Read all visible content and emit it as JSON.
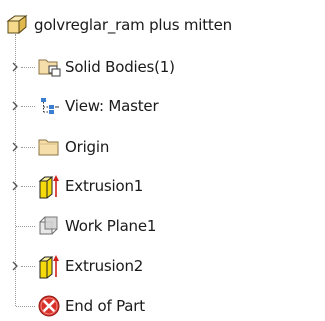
{
  "browser_tree": {
    "root": {
      "label": "golvreglar_ram plus mitten",
      "icon": "part-icon"
    },
    "items": [
      {
        "label": "Solid Bodies(1)",
        "icon": "solid-bodies-folder-icon",
        "expandable": true
      },
      {
        "label": "View: Master",
        "icon": "view-rep-icon",
        "expandable": true
      },
      {
        "label": "Origin",
        "icon": "folder-icon",
        "expandable": true
      },
      {
        "label": "Extrusion1",
        "icon": "extrusion-icon",
        "expandable": true
      },
      {
        "label": "Work Plane1",
        "icon": "work-plane-icon",
        "expandable": false
      },
      {
        "label": "Extrusion2",
        "icon": "extrusion-icon",
        "expandable": true
      },
      {
        "label": "End of Part",
        "icon": "end-of-part-icon",
        "expandable": false
      }
    ]
  },
  "colors": {
    "extrusion_yellow": "#f5d90a",
    "extrusion_arrow": "#d0201a",
    "end_of_part_red": "#d9302a",
    "folder_tan": "#f6deaa",
    "tree_line": "#9a9a9a"
  }
}
